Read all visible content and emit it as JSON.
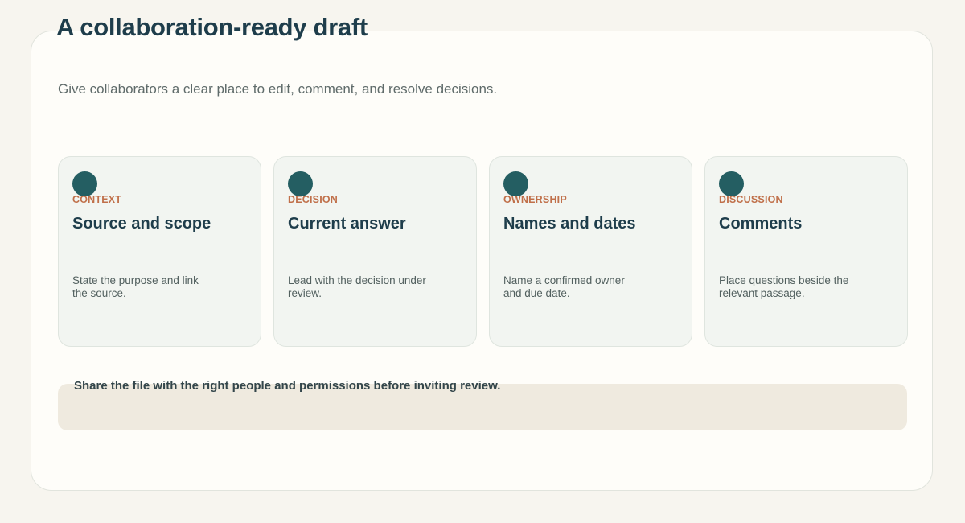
{
  "page": {
    "title": "A collaboration-ready draft",
    "subtitle": "Give collaborators a clear place to edit, comment, and resolve decisions."
  },
  "cards": [
    {
      "kicker": "CONTEXT",
      "title": "Source and scope",
      "description": "State the purpose and link the source."
    },
    {
      "kicker": "DECISION",
      "title": "Current answer",
      "description": "Lead with the decision under review."
    },
    {
      "kicker": "OWNERSHIP",
      "title": "Names and dates",
      "description": "Name a confirmed owner and due date."
    },
    {
      "kicker": "DISCUSSION",
      "title": "Comments",
      "description": "Place questions beside the relevant passage."
    }
  ],
  "notice": {
    "text": "Share the file with the right people and permissions before inviting review."
  },
  "colors": {
    "page_background": "#f7f5ef",
    "panel_background": "#fefdf9",
    "card_background": "#f2f5f1",
    "accent_dot": "#245e62",
    "kicker": "#c0704a",
    "heading": "#1e3d4b",
    "notice_background": "#efeadf"
  }
}
